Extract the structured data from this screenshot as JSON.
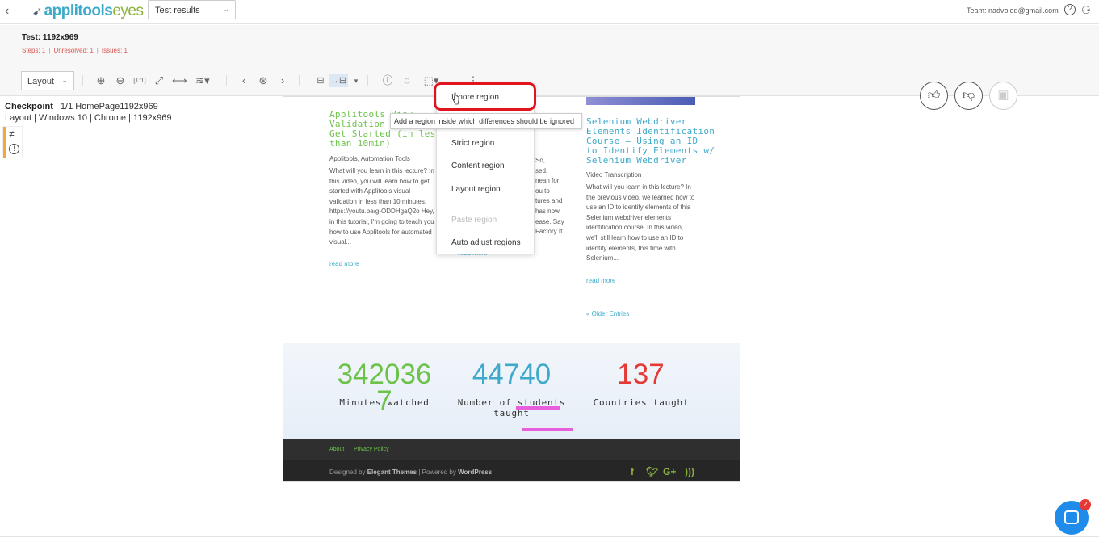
{
  "topbar": {
    "logo_app": "applitools",
    "logo_eyes": "eyes",
    "view_select": "Test results",
    "team": "Team: nadvolod@gmail.com"
  },
  "test": {
    "title": "Test:  1192x969",
    "steps": "Steps: 1",
    "unresolved": "Unresolved: 1",
    "issues": "Issues: 1"
  },
  "toolbar": {
    "mode_select": "Layout"
  },
  "checkpoint": {
    "label": "Checkpoint",
    "step": "1/1 HomePage1192x969",
    "mode": "Layout",
    "os": "Windows 10",
    "browser": "Chrome",
    "viewport": "1192x969"
  },
  "page": {
    "post1_title_l1": "Applitools Visu",
    "post1_title_l2": "Validation – R",
    "post1_title_l3": "Get Started (in less",
    "post1_title_l4": "than 10min)",
    "post1_meta": "Applitools, Automation Tools",
    "post1_body": "What will you learn in this lecture? In this video, you will learn how to get started with Applitools visual validation in less than 10 minutes. https://youtu.be/g-ODDHgaQ2o Hey, in this tutorial, I'm going to teach you how to use Applitools for automated visual...",
    "post1_readmore": "read more",
    "post2_frag1": "So,",
    "post2_frag2": "sed.",
    "post2_frag3": "nean for",
    "post2_frag4": "ou to",
    "post2_frag5": "tures and",
    "post2_frag6": "has now",
    "post2_frag7": "ease. Say",
    "post2_frag8": "Factory If",
    "post2_readmore": "read more",
    "post3_title_l1": "Selenium Webdriver",
    "post3_title_l2": "Elements Identification",
    "post3_title_l3": "Course – Using an ID",
    "post3_title_l4": "to Identify Elements w/",
    "post3_title_l5": "Selenium Webdriver",
    "post3_meta": "Video Transcription",
    "post3_body": "What will you learn in this lecture? In the previous video, we learned how to use an ID to identify elements of this Selenium webdriver elements identification course. In this video, we'll still learn how to use an ID to identify elements, this time with Selenium...",
    "post3_readmore": "read more",
    "older_entries": "« Older Entries",
    "stat1_value": "342036",
    "stat1_overflow": "7",
    "stat1_label": "Minutes watched",
    "stat2_value": "44740",
    "stat2_label_l1": "Number of students",
    "stat2_label_l2": "taught",
    "stat3_value": "137",
    "stat3_label": "Countries taught",
    "footer_about": "About",
    "footer_privacy": "Privacy Policy",
    "credit_prefix": "Designed by",
    "credit_theme": "Elegant Themes",
    "credit_mid": "| Powered by",
    "credit_wp": "WordPress"
  },
  "dropdown": {
    "items": [
      "Ignore region",
      "Strict region",
      "Content region",
      "Layout region",
      "Paste region",
      "Auto adjust regions"
    ]
  },
  "tooltip": "Add a region inside which differences should be ignored",
  "chat": {
    "badge": "2"
  },
  "colors": {
    "accent_blue": "#3fa9c9",
    "accent_green": "#6cc24a",
    "error_red": "#d9534f",
    "highlight_red": "#e0141f",
    "diff_pink": "#e84fd9",
    "stat3_red": "#e53935"
  }
}
